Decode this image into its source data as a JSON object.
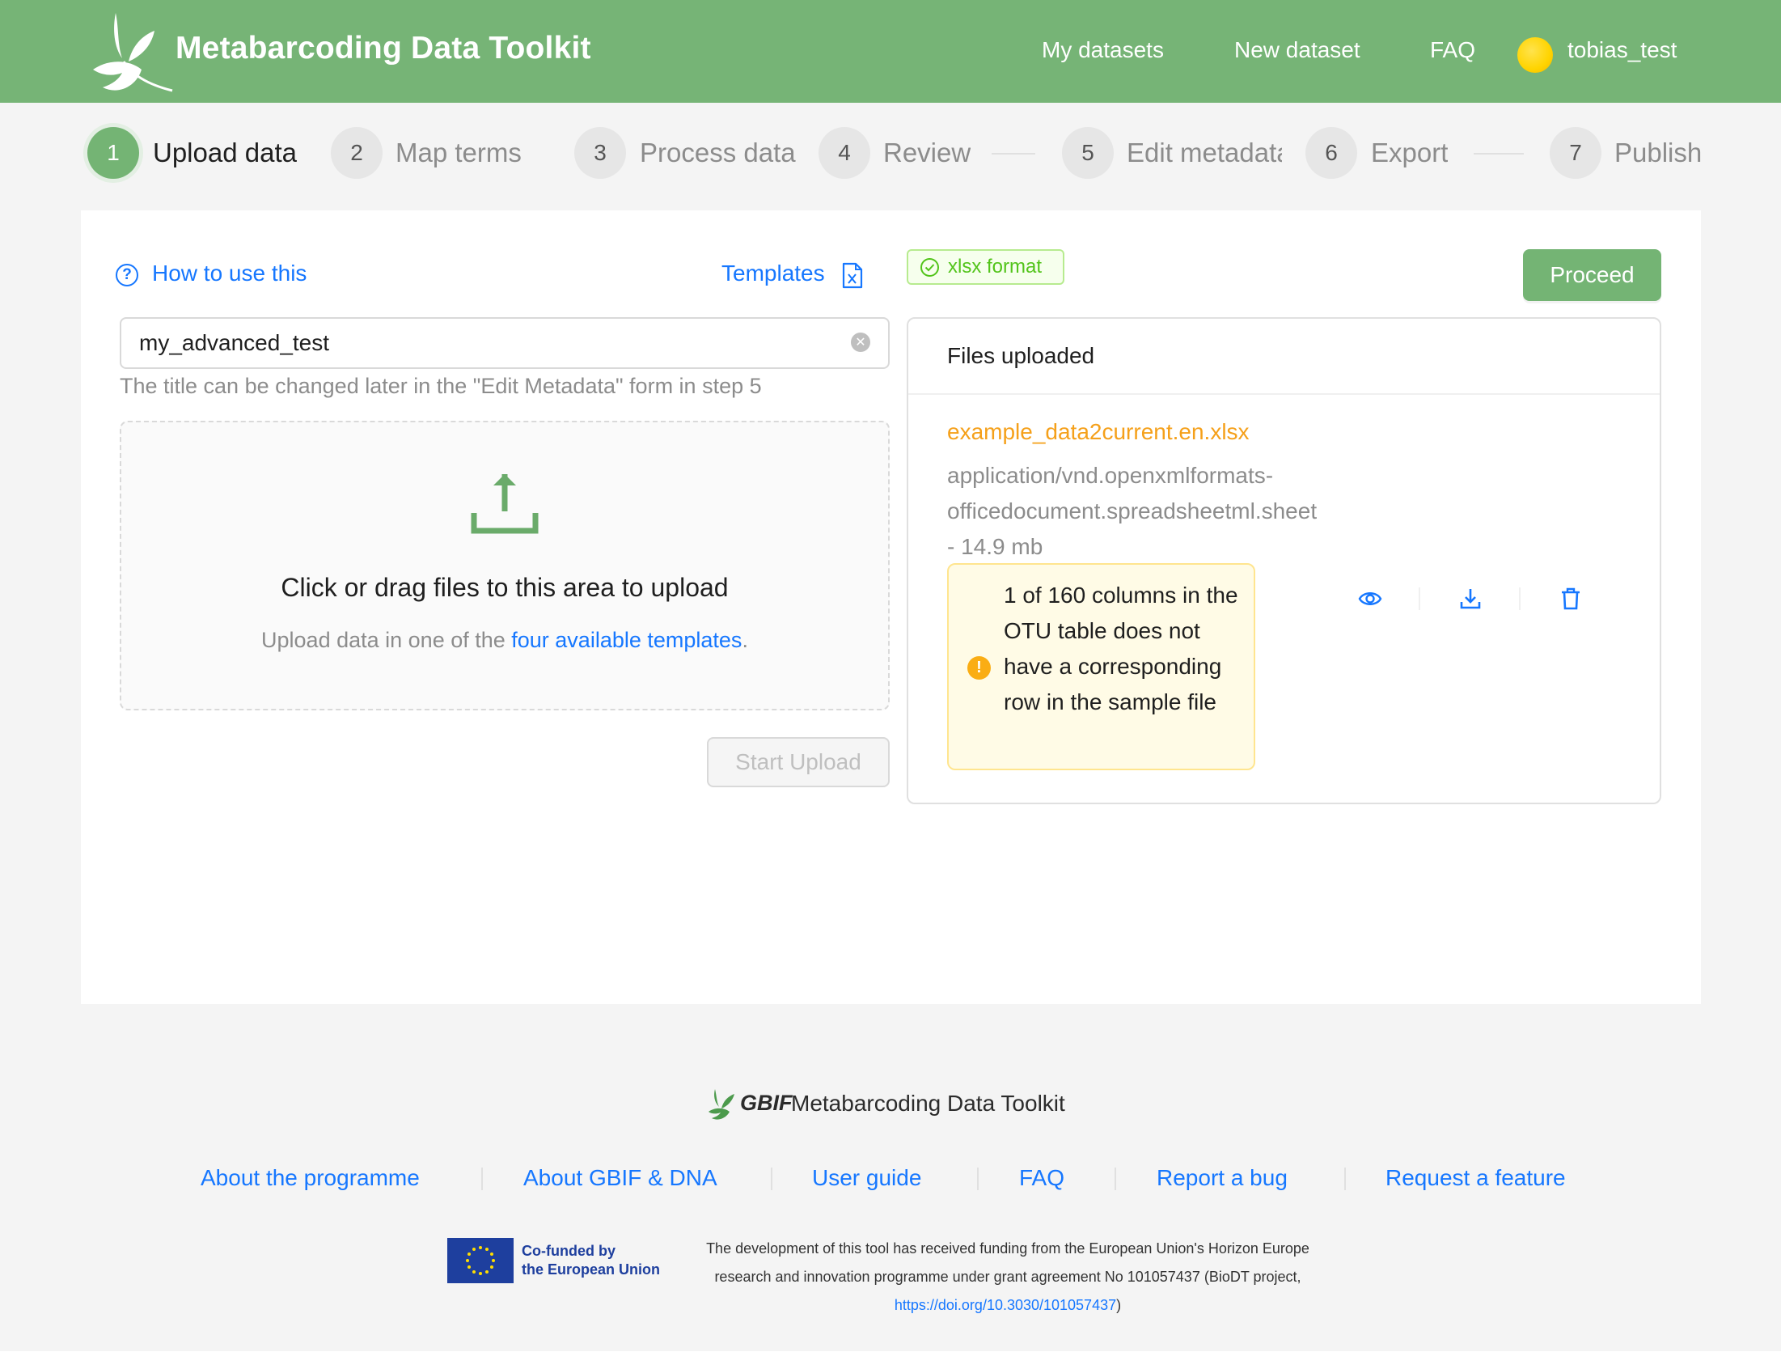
{
  "header": {
    "app_title": "Metabarcoding Data Toolkit",
    "nav": [
      "My datasets",
      "New dataset",
      "FAQ"
    ],
    "username": "tobias_test"
  },
  "steps": [
    {
      "number": "1",
      "label": "Upload data",
      "active": true
    },
    {
      "number": "2",
      "label": "Map terms"
    },
    {
      "number": "3",
      "label": "Process data"
    },
    {
      "number": "4",
      "label": "Review"
    },
    {
      "number": "5",
      "label": "Edit metadata"
    },
    {
      "number": "6",
      "label": "Export"
    },
    {
      "number": "7",
      "label": "Publish"
    }
  ],
  "upload": {
    "help_link": "How to use this",
    "templates_link": "Templates",
    "title_value": "my_advanced_test",
    "title_hint": "The title can be changed later in the \"Edit Metadata\" form in step 5",
    "drop_title": "Click or drag files to this area to upload",
    "drop_sub_prefix": "Upload data in one of the ",
    "drop_sub_link": "four available templates",
    "drop_sub_suffix": ".",
    "start_button": "Start Upload"
  },
  "status": {
    "format_tag": "xlsx format",
    "proceed_button": "Proceed"
  },
  "files": {
    "heading": "Files uploaded",
    "items": [
      {
        "name": "example_data2current.en.xlsx",
        "mime_line1": "application/vnd.openxmlformats-",
        "mime_line2": "officedocument.spreadsheetml.sheet",
        "size": "- 14.9 mb",
        "warning": "1 of 160 columns in the OTU table does not have a corresponding row in the sample file"
      }
    ]
  },
  "footer": {
    "brand_gbif": "GBIF",
    "brand_title": "Metabarcoding Data Toolkit",
    "links": [
      "About the programme",
      "About GBIF & DNA",
      "User guide",
      "FAQ",
      "Report a bug",
      "Request a feature"
    ],
    "eu_line1": "Co-funded by",
    "eu_line2": "the European Union",
    "funding_line1": "The development of this tool has received funding from the European Union's Horizon Europe",
    "funding_line2": "research and innovation programme under grant agreement No 101057437 (BioDT project,",
    "funding_link": "https://doi.org/10.3030/101057437",
    "funding_close": ")"
  },
  "colors": {
    "brand_green": "#76b476",
    "link_blue": "#1677ff",
    "file_orange": "#f5a01a",
    "warning_bg": "#fffbe6"
  }
}
